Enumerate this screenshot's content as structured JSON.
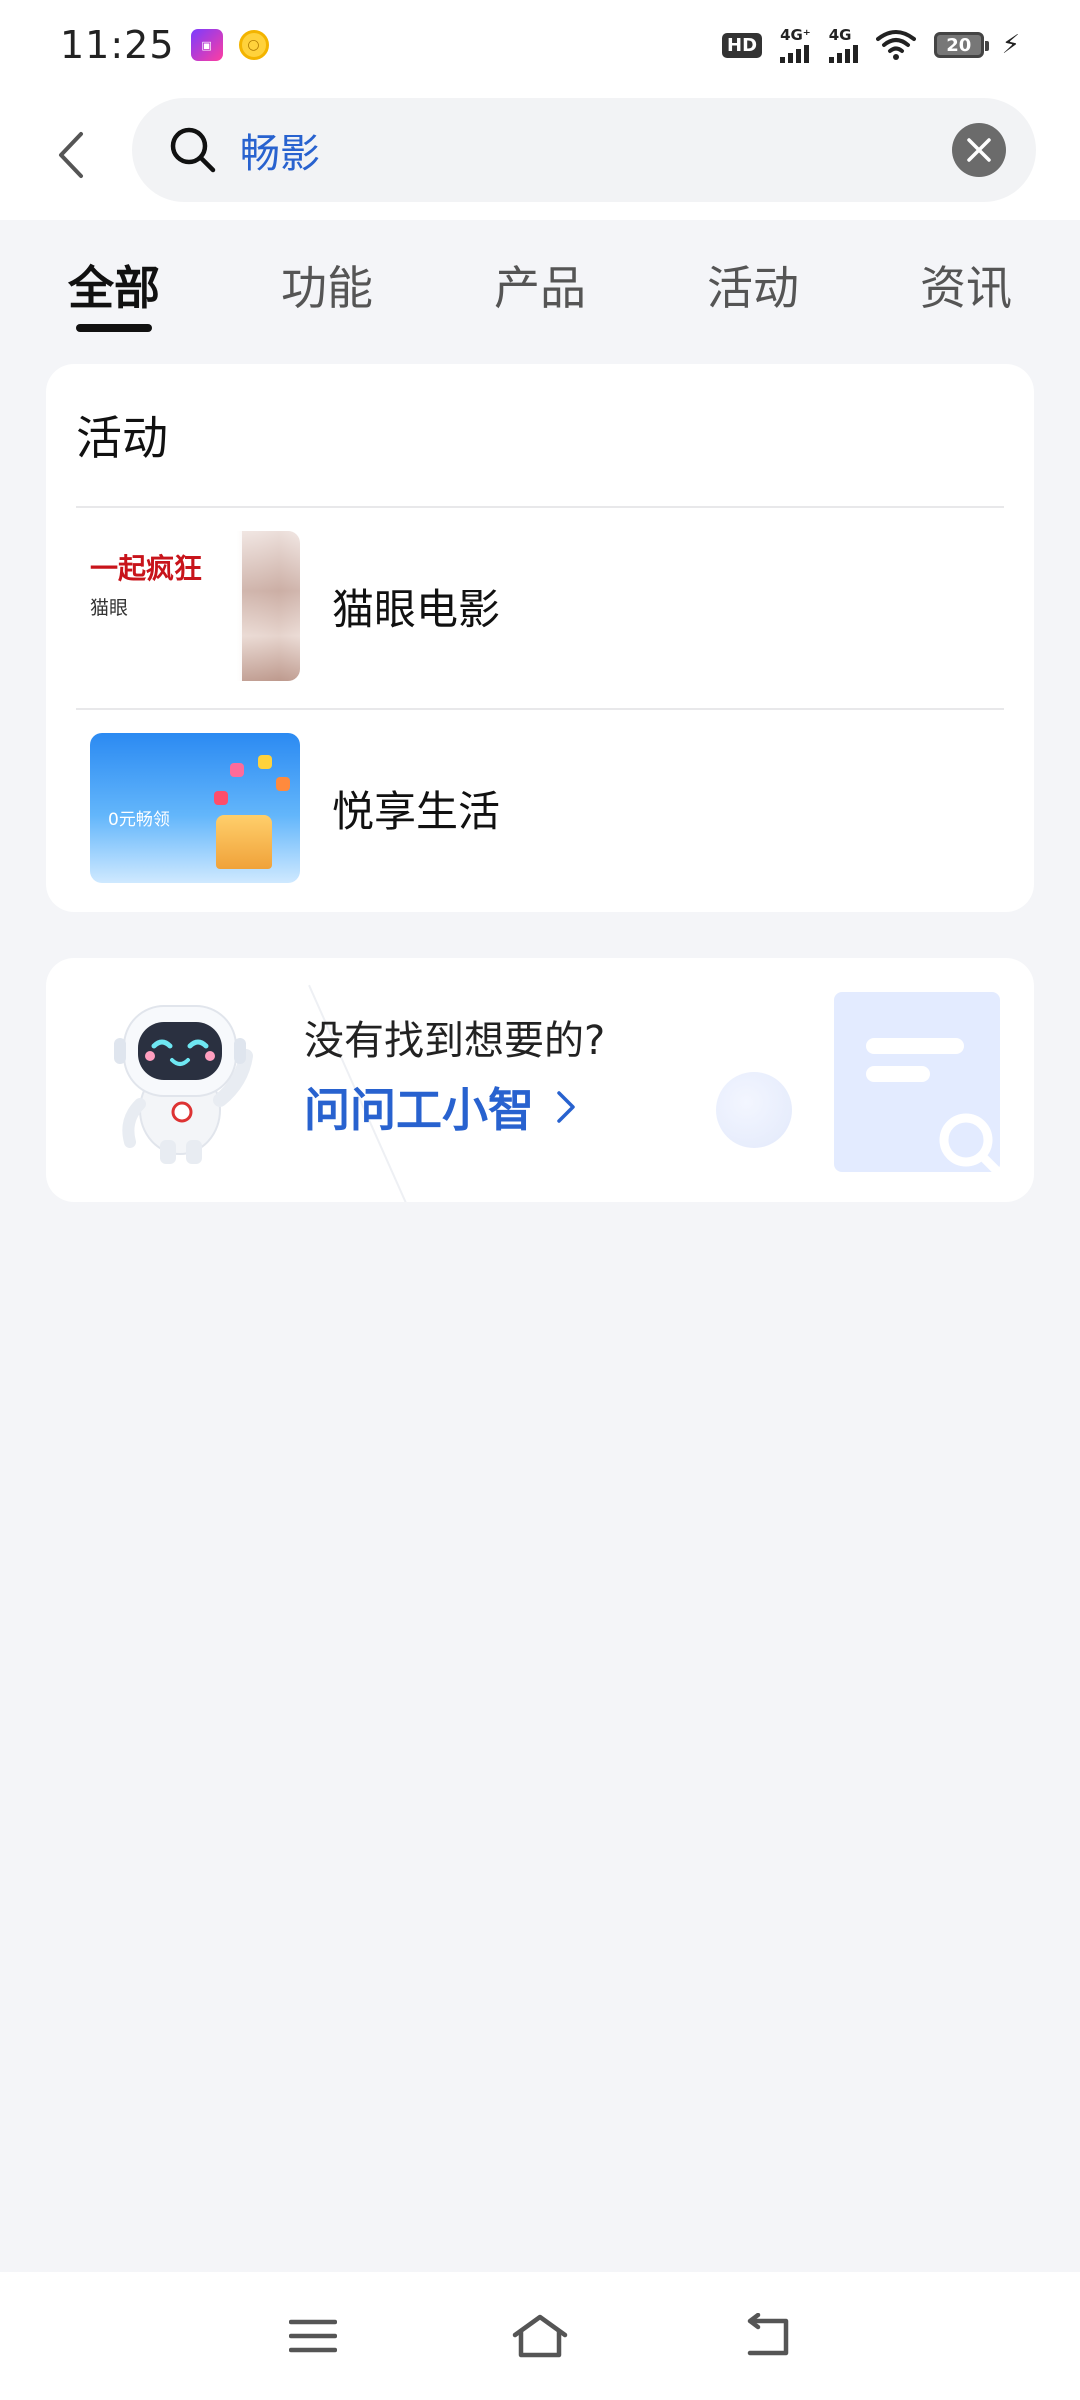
{
  "status_bar": {
    "time": "11:25",
    "hd_label": "HD",
    "network_1": "4G⁺",
    "network_2": "4G",
    "battery_level": "20",
    "app_badge_icon": "app-notification-icon",
    "coin_icon": "coin-icon"
  },
  "search": {
    "query": "畅影",
    "back_icon": "chevron-left-icon",
    "search_icon": "search-icon",
    "clear_icon": "clear-circle-icon"
  },
  "tabs": [
    {
      "label": "全部",
      "active": true
    },
    {
      "label": "功能",
      "active": false
    },
    {
      "label": "产品",
      "active": false
    },
    {
      "label": "活动",
      "active": false
    },
    {
      "label": "资讯",
      "active": false
    }
  ],
  "activity_section": {
    "title": "活动",
    "items": [
      {
        "label": "猫眼电影",
        "thumb_title": "一起疯狂",
        "thumb_sub": "猫眼"
      },
      {
        "label": "悦享生活",
        "thumb_title": "0元畅领"
      }
    ]
  },
  "assistant": {
    "question": "没有找到想要的?",
    "link_label": "问问工小智",
    "link_icon": "chevron-right-icon",
    "robot_icon": "robot-assistant-icon",
    "doc_icon": "document-search-icon"
  },
  "bottom_nav": {
    "menu_icon": "menu-icon",
    "home_icon": "home-icon",
    "back_icon": "back-icon"
  },
  "colors": {
    "accent": "#2862cf",
    "background": "#f4f5f8",
    "card": "#ffffff",
    "promo_red": "#c8141b"
  }
}
